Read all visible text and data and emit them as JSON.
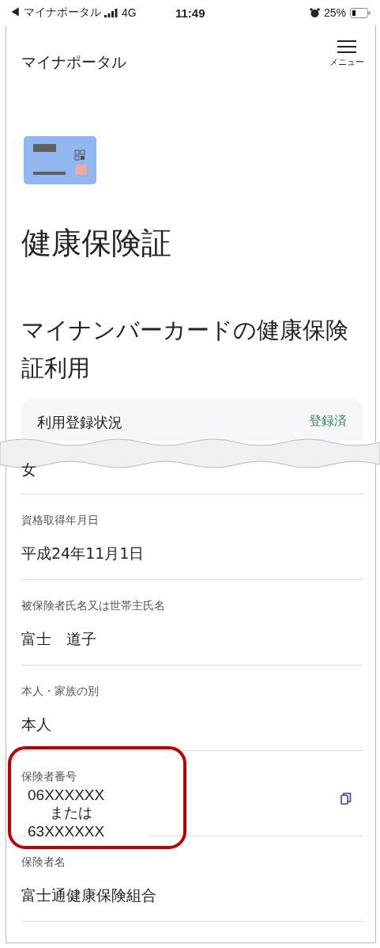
{
  "status_bar": {
    "back_arrow": "◀",
    "back_label": "マイナポータル",
    "carrier": "4G",
    "time": "11:49",
    "battery": "25%"
  },
  "header": {
    "title": "マイナポータル",
    "menu_label": "メニュー"
  },
  "page_title": "健康保険証",
  "section_title": "マイナンバーカードの健康保険証利用",
  "status_card": {
    "label": "利用登録状況",
    "value": "登録済"
  },
  "fields": [
    {
      "kind": "text",
      "value": "女"
    },
    {
      "kind": "text",
      "label": "資格取得年月日",
      "value": "平成24年11月1日"
    },
    {
      "kind": "text",
      "label": "被保険者氏名又は世帯主氏名",
      "value": "富士　道子"
    },
    {
      "kind": "text",
      "label": "本人・家族の別",
      "value": "本人"
    },
    {
      "kind": "copy",
      "label": "保険者番号",
      "value_lines": [
        "06XXXXXX",
        "または",
        "63XXXXXX"
      ]
    },
    {
      "kind": "text",
      "label": "保険者名",
      "value": "富士通健康保険組合"
    }
  ]
}
